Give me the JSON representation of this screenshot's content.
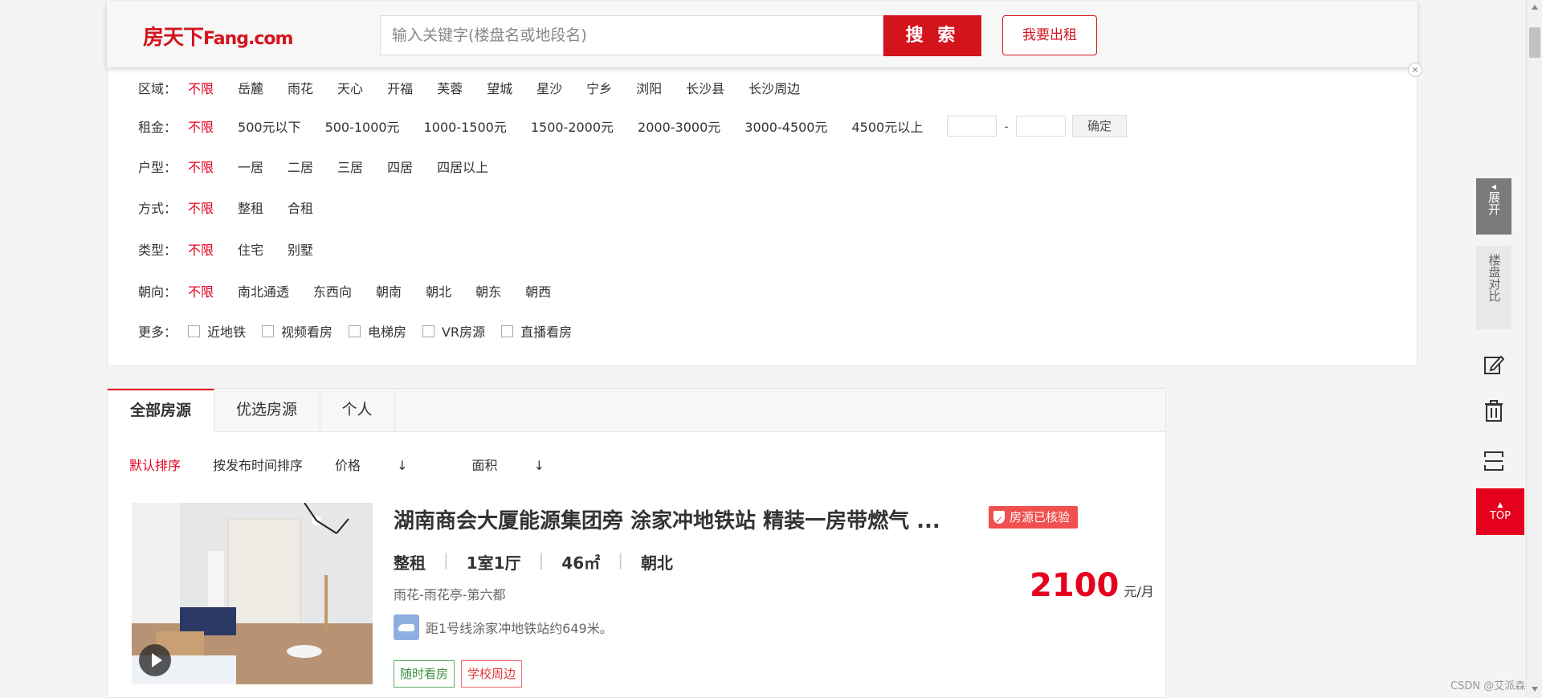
{
  "header": {
    "logo_cn": "房天下",
    "logo_en": "Fang.com",
    "search_placeholder": "输入关键字(楼盘名或地段名)",
    "search_button": "搜 索",
    "rent_out_button": "我要出租",
    "close_glyph": "×"
  },
  "filters": {
    "area": {
      "label": "区域：",
      "options": [
        "不限",
        "岳麓",
        "雨花",
        "天心",
        "开福",
        "芙蓉",
        "望城",
        "星沙",
        "宁乡",
        "浏阳",
        "长沙县",
        "长沙周边"
      ]
    },
    "rent": {
      "label": "租金：",
      "options": [
        "不限",
        "500元以下",
        "500-1000元",
        "1000-1500元",
        "1500-2000元",
        "2000-3000元",
        "3000-4500元",
        "4500元以上"
      ],
      "range_sep": "-",
      "confirm": "确定"
    },
    "layout": {
      "label": "户型：",
      "options": [
        "不限",
        "一居",
        "二居",
        "三居",
        "四居",
        "四居以上"
      ]
    },
    "mode": {
      "label": "方式：",
      "options": [
        "不限",
        "整租",
        "合租"
      ]
    },
    "type": {
      "label": "类型：",
      "options": [
        "不限",
        "住宅",
        "别墅"
      ]
    },
    "facing": {
      "label": "朝向：",
      "options": [
        "不限",
        "南北通透",
        "东西向",
        "朝南",
        "朝北",
        "朝东",
        "朝西"
      ]
    },
    "more": {
      "label": "更多：",
      "options": [
        "近地铁",
        "视频看房",
        "电梯房",
        "VR房源",
        "直播看房"
      ]
    }
  },
  "tabs": [
    "全部房源",
    "优选房源",
    "个人"
  ],
  "sorts": [
    "默认排序",
    "按发布时间排序",
    "价格",
    "面积"
  ],
  "sort_arrow": "↓",
  "listing": {
    "title": "湖南商会大厦能源集团旁 涂家冲地铁站 精装一房带燃气 ...",
    "verified": "房源已核验",
    "specs": [
      "整租",
      "1室1厅",
      "46㎡",
      "朝北"
    ],
    "spec_sep": "|",
    "address": "雨花-雨花亭-第六都",
    "subway": "距1号线涂家冲地铁站约649米。",
    "tags": [
      "随时看房",
      "学校周边"
    ],
    "price": "2100",
    "price_unit": "元/月"
  },
  "toolbar": {
    "expand": "展开",
    "compare": "楼盘对比",
    "top": "TOP"
  },
  "watermark": "CSDN @艾派森",
  "colors": {
    "brand_red": "#d4141c",
    "active_red": "#e5001e",
    "verified_red": "#f0504f"
  }
}
